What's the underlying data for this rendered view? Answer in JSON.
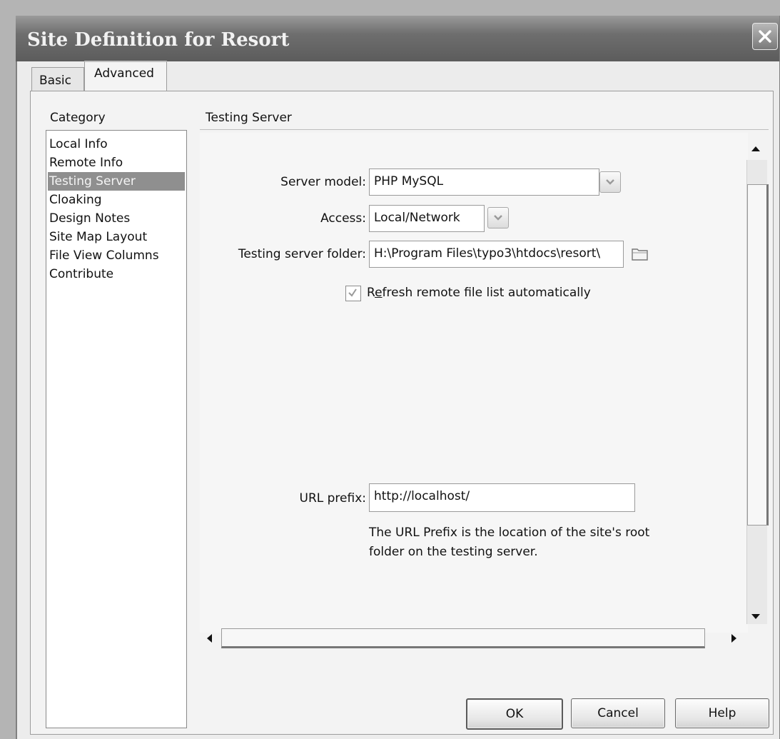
{
  "window": {
    "title": "Site Definition for Resort",
    "close_icon": "close-icon"
  },
  "tabs": [
    {
      "label": "Basic",
      "active": false
    },
    {
      "label": "Advanced",
      "active": true
    }
  ],
  "category": {
    "heading": "Category",
    "items": [
      {
        "label": "Local Info",
        "selected": false
      },
      {
        "label": "Remote Info",
        "selected": false
      },
      {
        "label": "Testing Server",
        "selected": true
      },
      {
        "label": "Cloaking",
        "selected": false
      },
      {
        "label": "Design Notes",
        "selected": false
      },
      {
        "label": "Site Map Layout",
        "selected": false
      },
      {
        "label": "File View Columns",
        "selected": false
      },
      {
        "label": "Contribute",
        "selected": false
      }
    ]
  },
  "section": {
    "title": "Testing Server",
    "server_model": {
      "label": "Server model:",
      "value": "PHP MySQL"
    },
    "access": {
      "label": "Access:",
      "value": "Local/Network"
    },
    "testing_folder": {
      "label": "Testing server folder:",
      "value": "H:\\Program Files\\typo3\\htdocs\\resort\\"
    },
    "refresh": {
      "label_before": "R",
      "label_mnemonic": "e",
      "label_after": "fresh remote file list automatically",
      "checked": true
    },
    "url_prefix": {
      "label": "URL prefix:",
      "value": "http://localhost/"
    },
    "help_text": "The URL Prefix is the location of the site's root folder on the testing server."
  },
  "buttons": {
    "ok": "OK",
    "cancel": "Cancel",
    "help": "Help"
  },
  "colors": {
    "selected_bg": "#8f8f8f",
    "titlebar": "#6e6e6e"
  }
}
